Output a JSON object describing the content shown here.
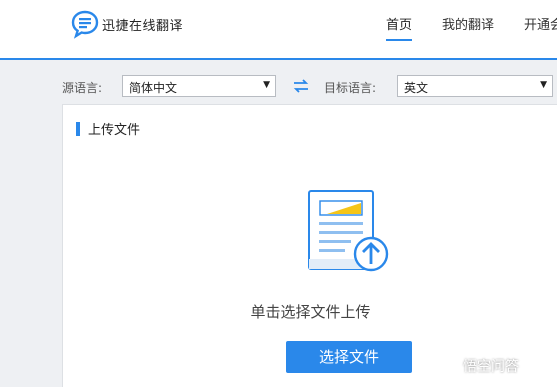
{
  "header": {
    "logo_text": "迅捷在线翻译",
    "nav": [
      {
        "label": "首页",
        "active": true
      },
      {
        "label": "我的翻译",
        "active": false
      },
      {
        "label": "开通会",
        "active": false
      }
    ],
    "accent_color": "#2a88ea"
  },
  "language_bar": {
    "source_label": "源语言:",
    "source_value": "简体中文",
    "target_label": "目标语言:",
    "target_value": "英文",
    "swap_icon": "swap-arrows-icon"
  },
  "upload_panel": {
    "title": "上传文件",
    "hint": "单击选择文件上传",
    "button_label": "选择文件",
    "icon": "document-upload-icon"
  },
  "watermark": {
    "text": "悟空问答"
  }
}
